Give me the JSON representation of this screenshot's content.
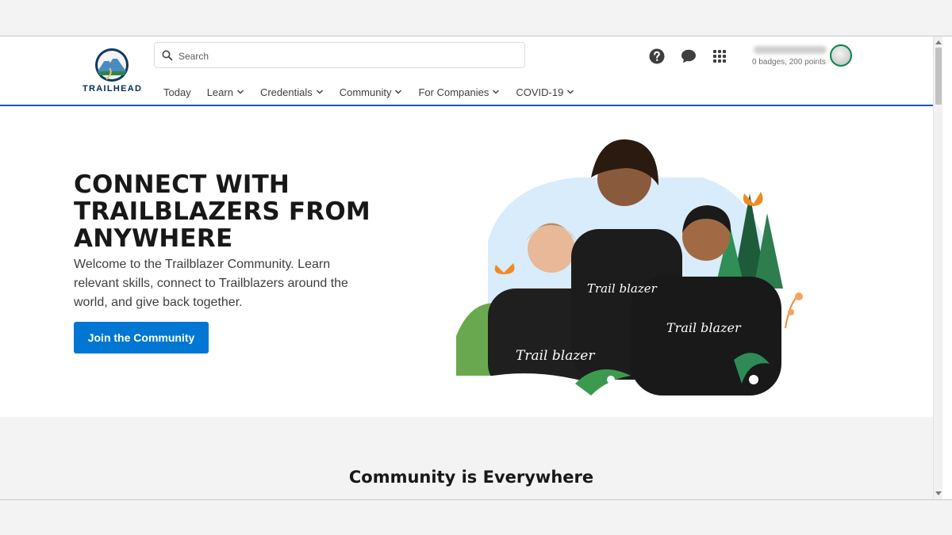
{
  "brand": {
    "name": "TRAILHEAD"
  },
  "search": {
    "placeholder": "Search"
  },
  "nav": {
    "items": [
      {
        "label": "Today"
      },
      {
        "label": "Learn"
      },
      {
        "label": "Credentials"
      },
      {
        "label": "Community"
      },
      {
        "label": "For Companies"
      },
      {
        "label": "COVID-19"
      }
    ]
  },
  "header_icons": [
    "help-icon",
    "chat-icon",
    "app-launcher-icon"
  ],
  "user": {
    "points": "0 badges, 200 points"
  },
  "hero": {
    "title": "CONNECT WITH\nTRAILBLAZERS FROM\nANYWHERE",
    "description": "Welcome to the Trailblazer Community. Learn relevant skills, connect to Trailblazers around the world, and give back together.",
    "cta_label": "Join the Community",
    "image_text": "Trail blazer"
  },
  "section": {
    "title": "Community is Everywhere"
  },
  "colors": {
    "accent": "#0176d3",
    "nav_border": "#0b5cab",
    "brand_dark": "#032d60",
    "avatar_ring": "#04844b"
  }
}
